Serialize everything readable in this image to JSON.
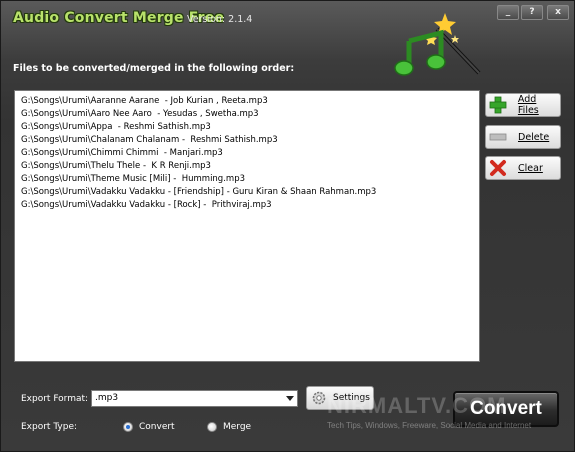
{
  "window": {
    "app_title": "Audio Convert Merge Free",
    "version": "Version: 2.1.4",
    "minimize_label": "_",
    "help_label": "?",
    "close_label": "x"
  },
  "files_label": "Files to be converted/merged in the following order:",
  "files": [
    "G:\\Songs\\Urumi\\Aaranne Aarane  - Job Kurian , Reeta.mp3",
    "G:\\Songs\\Urumi\\Aaro Nee Aaro  - Yesudas , Swetha.mp3",
    "G:\\Songs\\Urumi\\Appa  - Reshmi Sathish.mp3",
    "G:\\Songs\\Urumi\\Chalanam Chalanam -  Reshmi Sathish.mp3",
    "G:\\Songs\\Urumi\\Chimmi Chimmi  - Manjari.mp3",
    "G:\\Songs\\Urumi\\Thelu Thele -  K R Renji.mp3",
    "G:\\Songs\\Urumi\\Theme Music [Mili] -  Humming.mp3",
    "G:\\Songs\\Urumi\\Vadakku Vadakku - [Friendship] - Guru Kiran & Shaan Rahman.mp3",
    "G:\\Songs\\Urumi\\Vadakku Vadakku - [Rock] -  Prithviraj.mp3"
  ],
  "buttons": {
    "add_files": "Add Files",
    "delete": "Delete",
    "clear": "Clear",
    "settings": "Settings",
    "convert": "Convert"
  },
  "export": {
    "format_label": "Export Format:",
    "format_value": ".mp3",
    "type_label": "Export Type:",
    "type_options": [
      "Convert",
      "Merge"
    ],
    "type_selected": "Convert"
  },
  "watermark": {
    "brand": "NIRMALTV.COM",
    "tagline": "Tech Tips, Windows, Freeware, Social Media and Internet"
  },
  "icons": {
    "add": "plus-icon",
    "delete": "minus-icon",
    "clear": "x-icon",
    "settings": "gear-icon",
    "logo": "music-note-wand-icon"
  },
  "colors": {
    "title_green": "#b9e26b",
    "add_green": "#36a52a",
    "clear_red": "#d22a1e"
  }
}
